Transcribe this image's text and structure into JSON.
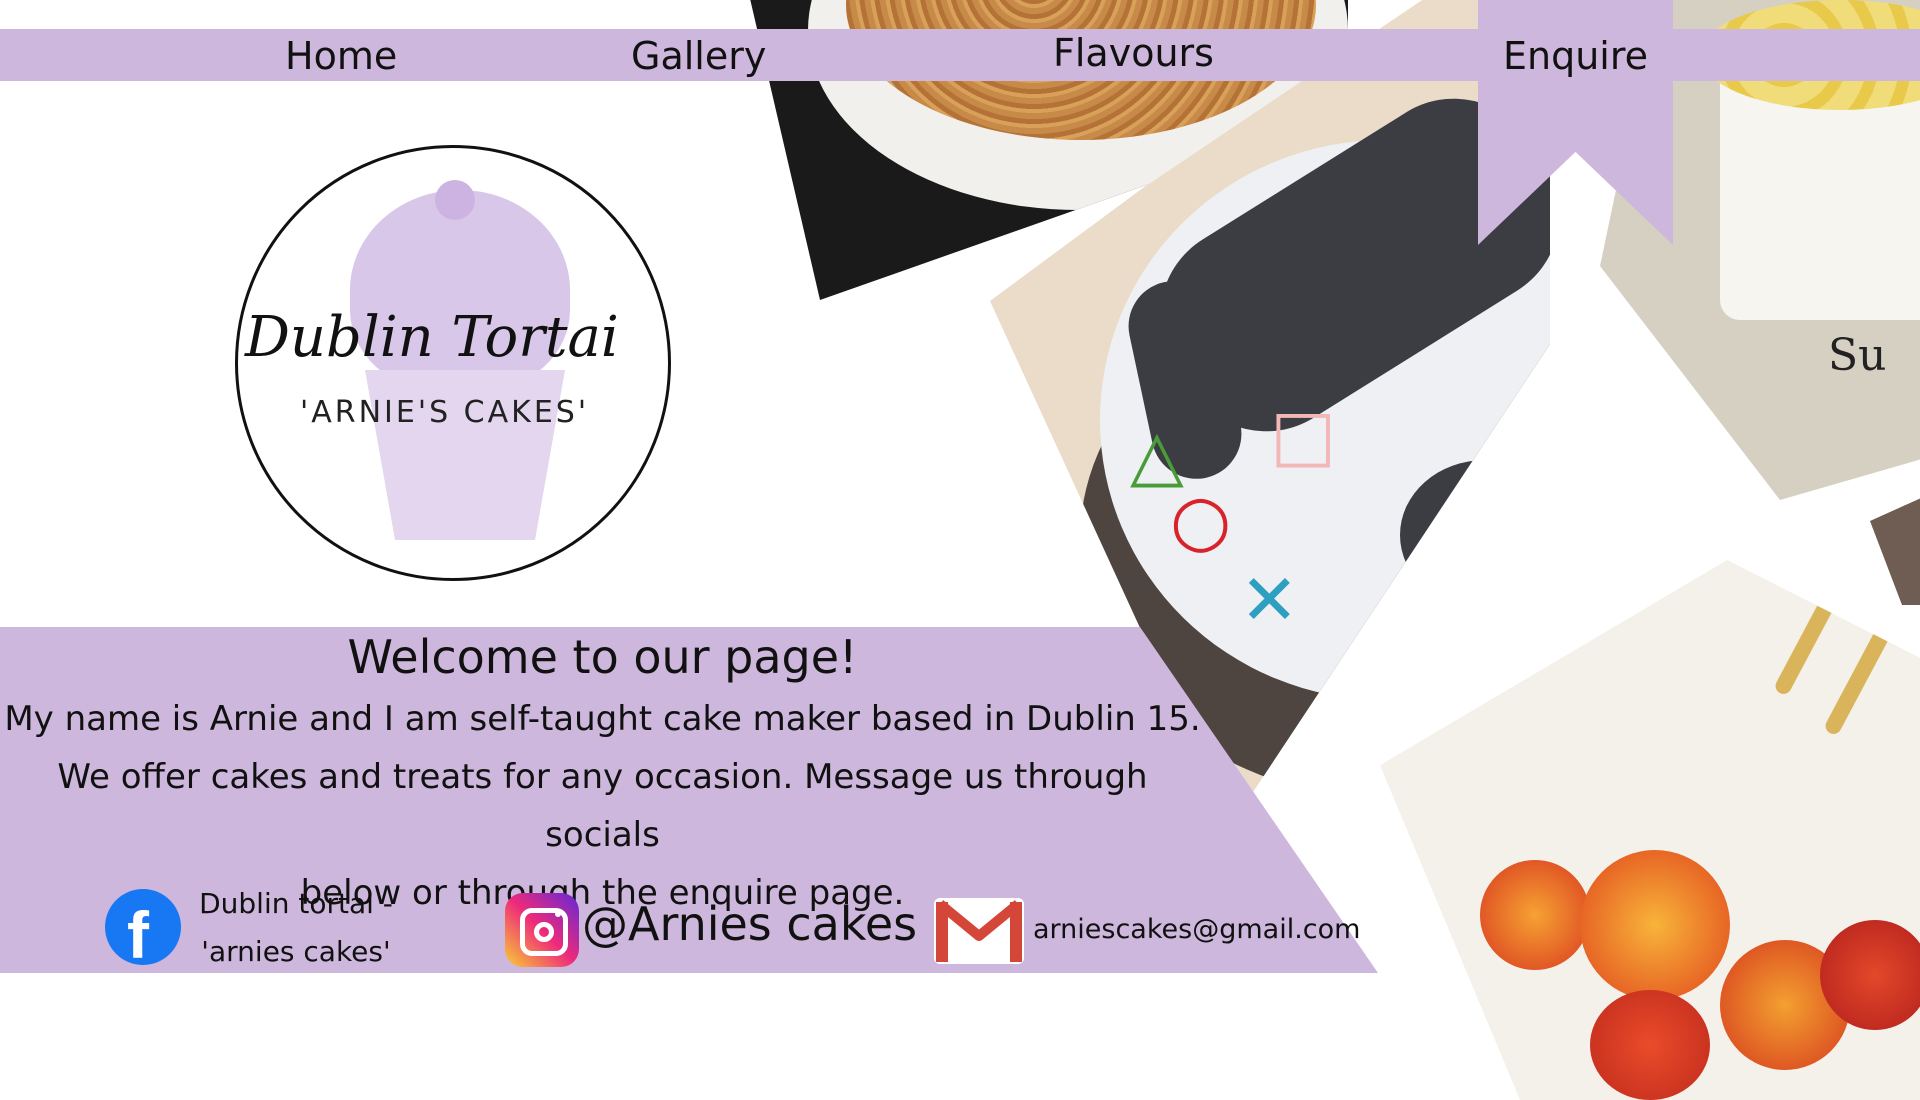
{
  "nav": {
    "home": "Home",
    "gallery": "Gallery",
    "flavours": "Flavours",
    "enquire": "Enquire"
  },
  "logo": {
    "script_title": "Dublin Tortai",
    "subtitle": "'ARNIE'S CAKES'"
  },
  "welcome": {
    "title": "Welcome to our page!",
    "line1": "My name is Arnie and I am self-taught cake maker based in Dublin 15.",
    "line2": "We offer cakes and treats for any occasion. Message us through socials",
    "line3": "below or through the enquire page."
  },
  "photos": {
    "right_cake_text": "Su"
  },
  "socials": {
    "facebook_line1": "Dublin tortai -",
    "facebook_line2": "'arnies cakes'",
    "facebook_icon": "facebook-icon",
    "instagram": "@Arnies cakes",
    "instagram_icon": "instagram-icon",
    "email": "arniescakes@gmail.com",
    "email_icon": "gmail-icon"
  },
  "colors": {
    "accent": "#cdb7dc",
    "facebook": "#1877f2"
  }
}
